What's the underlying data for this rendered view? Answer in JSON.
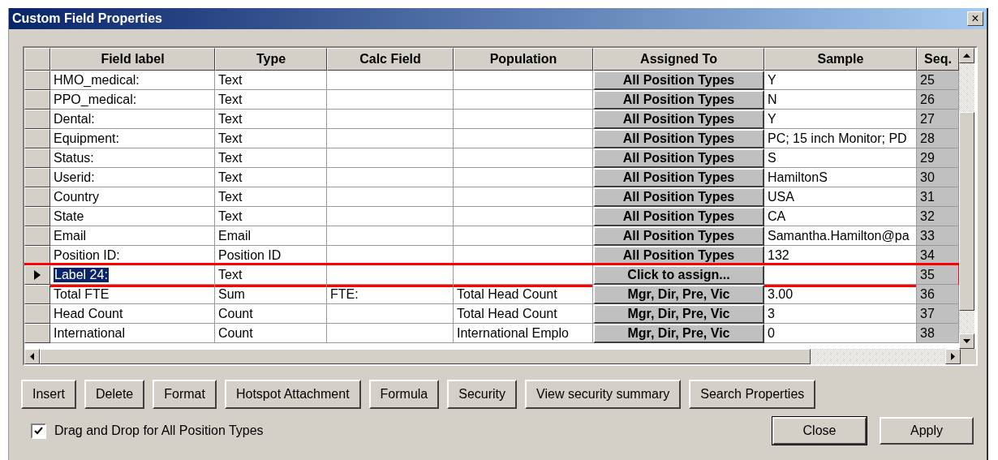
{
  "window": {
    "title": "Custom Field Properties",
    "close": "×"
  },
  "table": {
    "columns": [
      "Field label",
      "Type",
      "Calc Field",
      "Population",
      "Assigned To",
      "Sample",
      "Seq."
    ],
    "rows": [
      {
        "selected": false,
        "cells": [
          "HMO_medical:",
          "Text",
          "",
          "",
          "All Position Types",
          "Y",
          "25"
        ]
      },
      {
        "selected": false,
        "cells": [
          "PPO_medical:",
          "Text",
          "",
          "",
          "All Position Types",
          "N",
          "26"
        ]
      },
      {
        "selected": false,
        "cells": [
          "Dental:",
          "Text",
          "",
          "",
          "All Position Types",
          "Y",
          "27"
        ]
      },
      {
        "selected": false,
        "cells": [
          "Equipment:",
          "Text",
          "",
          "",
          "All Position Types",
          "PC; 15 inch Monitor; PD",
          "28"
        ]
      },
      {
        "selected": false,
        "cells": [
          "Status:",
          "Text",
          "",
          "",
          "All Position Types",
          "S",
          "29"
        ]
      },
      {
        "selected": false,
        "cells": [
          "Userid:",
          "Text",
          "",
          "",
          "All Position Types",
          "HamiltonS",
          "30"
        ]
      },
      {
        "selected": false,
        "cells": [
          "Country",
          "Text",
          "",
          "",
          "All Position Types",
          "USA",
          "31"
        ]
      },
      {
        "selected": false,
        "cells": [
          "State",
          "Text",
          "",
          "",
          "All Position Types",
          "CA",
          "32"
        ]
      },
      {
        "selected": false,
        "cells": [
          "Email",
          "Email",
          "",
          "",
          "All Position Types",
          "Samantha.Hamilton@pa",
          "33"
        ]
      },
      {
        "selected": false,
        "cells": [
          "Position ID:",
          "Position ID",
          "",
          "",
          "All Position Types",
          "132",
          "34"
        ]
      },
      {
        "selected": true,
        "cells": [
          "Label 24:",
          "Text",
          "",
          "",
          "Click to assign...",
          "",
          "35"
        ]
      },
      {
        "selected": false,
        "cells": [
          "Total FTE",
          "Sum",
          "FTE:",
          "Total Head Count",
          "Mgr, Dir, Pre, Vic",
          "3.00",
          "36"
        ]
      },
      {
        "selected": false,
        "cells": [
          "Head Count",
          "Count",
          "",
          "Total Head Count",
          "Mgr, Dir, Pre, Vic",
          "3",
          "37"
        ]
      },
      {
        "selected": false,
        "cells": [
          "International",
          "Count",
          "",
          "International Emplo",
          "Mgr, Dir, Pre, Vic",
          "0",
          "38"
        ]
      }
    ]
  },
  "buttons": [
    "Insert",
    "Delete",
    "Format",
    "Hotspot Attachment",
    "Formula",
    "Security",
    "View security summary",
    "Search Properties"
  ],
  "checkbox": {
    "label": "Drag and Drop for All Position Types",
    "checked": true
  },
  "dialog_buttons": [
    {
      "label": "Close",
      "default": true
    },
    {
      "label": "Apply",
      "default": false
    }
  ]
}
